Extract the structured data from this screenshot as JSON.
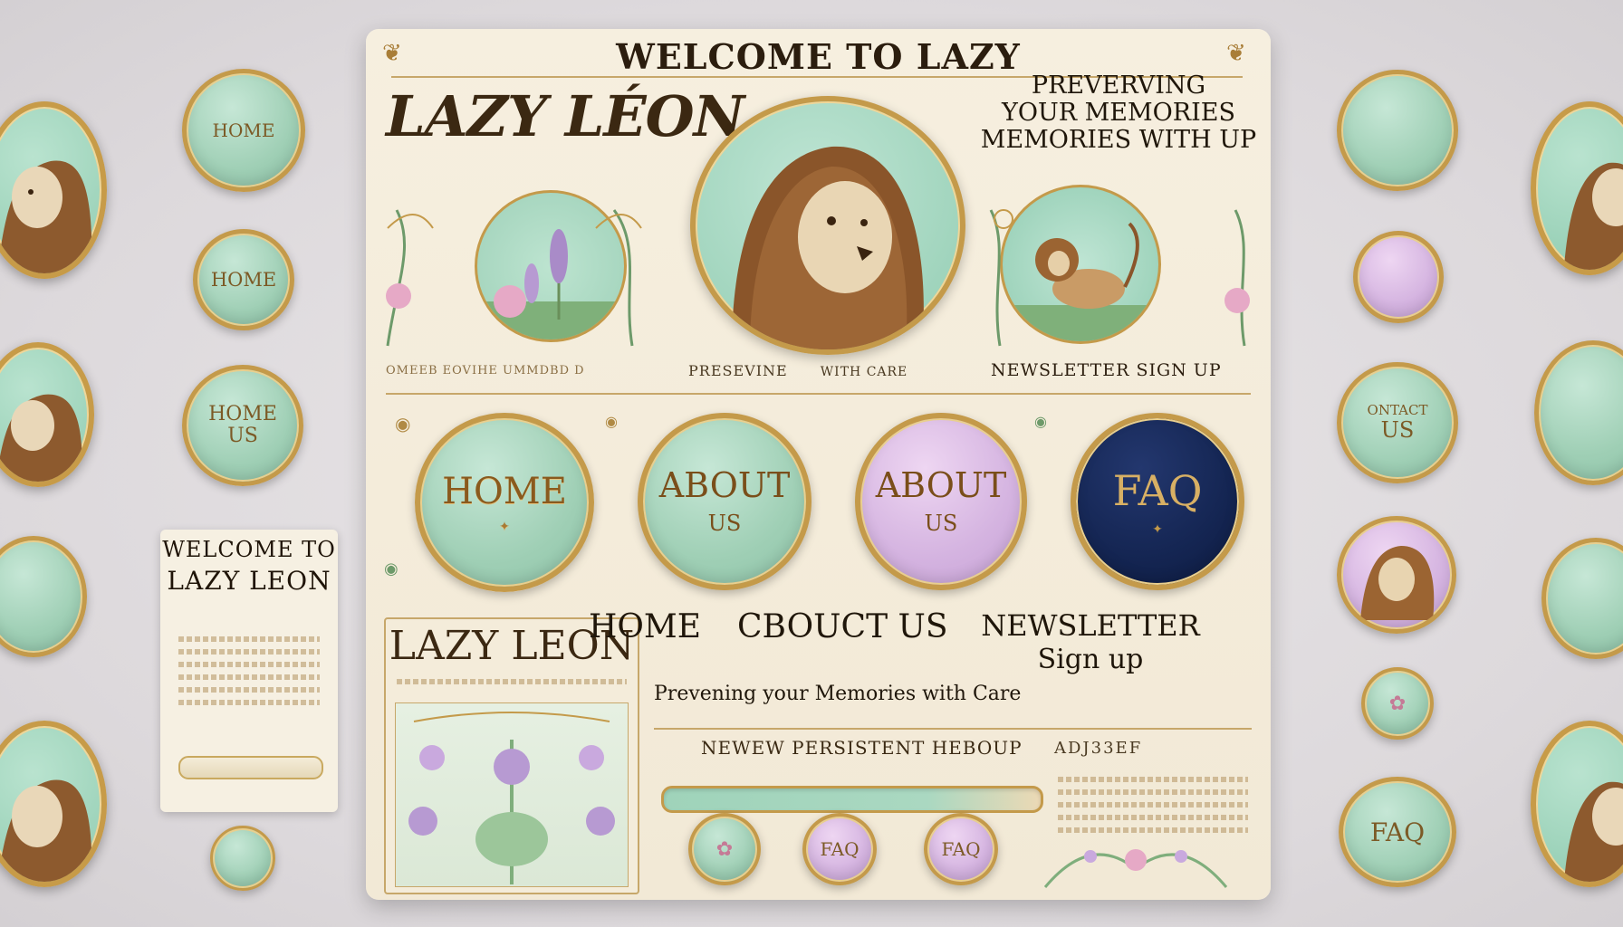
{
  "header": {
    "welcome": "WELCOME TO LAZY",
    "logo": "LAZY LÉON",
    "tagline_line1": "PREVERVING",
    "tagline_line2": "YOUR MEMORIES",
    "tagline_line3": "MEMORIES WITH UP"
  },
  "subnav": {
    "left": "OMEEB EOVIHE  UMMDBD D",
    "center": "PRESEVINE",
    "center_small": "WITH CARE",
    "right": "NEWSLETTER SIGN UP"
  },
  "main_buttons": [
    {
      "label": "HOME",
      "sub": ""
    },
    {
      "label": "ABOUT",
      "sub": "US"
    },
    {
      "label": "ABOUT",
      "sub": "US"
    },
    {
      "label": "FAQ",
      "sub": ""
    }
  ],
  "menu_text": {
    "home": "HOME",
    "about": "CBOUCT US",
    "newsletter_line1": "NEWSLETTER",
    "newsletter_line2": "Sign up",
    "tagline": "Prevening your Memories with Care"
  },
  "card": {
    "logo": "LAZY LEON"
  },
  "form": {
    "label": "NEWEW PERSISTENT HEBOUP",
    "side_label": "ADJ33EF"
  },
  "small_buttons": [
    {
      "label": ""
    },
    {
      "label": "FAQ"
    },
    {
      "label": "FAQ"
    }
  ],
  "left_panel": {
    "buttons": [
      "HOME",
      "HOME",
      "HOME",
      "US"
    ],
    "card_line1": "WELCOME TO",
    "card_line2": "LAZY LEON"
  },
  "right_panel": {
    "contact_line1": "ONTACT",
    "contact_line2": "US",
    "faq": "FAQ"
  },
  "colors": {
    "mint": "#9fcfb5",
    "lavender": "#d4b3e0",
    "navy": "#142552",
    "gold": "#c49a4a",
    "cream": "#f4ecdb"
  }
}
